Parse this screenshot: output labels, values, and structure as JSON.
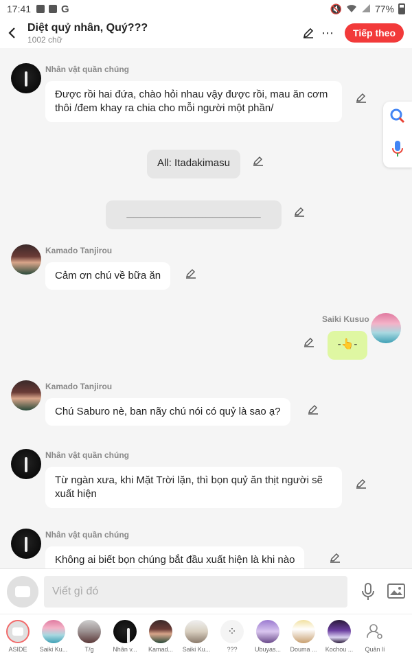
{
  "status_bar": {
    "time": "17:41",
    "battery": "77%"
  },
  "header": {
    "title": "Diệt quỷ nhân, Quý???",
    "subtitle": "1002 chữ",
    "follow_label": "Tiếp theo"
  },
  "messages": [
    {
      "name": "Nhân vật quần chúng",
      "text": "Được rồi hai đứa, chào hỏi nhau vậy được rồi, mau ăn cơm thôi /đem khay ra chia cho mỗi người một phần/"
    },
    {
      "text": "All: Itadakimasu"
    },
    {
      "text": "_______________________________________"
    },
    {
      "name": "Kamado Tanjirou",
      "text": "Cảm ơn chú về bữa ăn"
    },
    {
      "name": "Saiki Kusuo",
      "text": "-👆-"
    },
    {
      "name": "Kamado Tanjirou",
      "text": "Chú Saburo nè, ban nãy chú nói có quỷ là sao ạ?"
    },
    {
      "name": "Nhân vật quần chúng",
      "text": "Từ ngàn xưa, khi Mặt Trời lặn, thì bọn quỷ ăn thịt người sẽ xuất hiện"
    },
    {
      "name": "Nhân vật quần chúng",
      "text": "Không ai biết bọn chúng bắt đầu xuất hiện là khi nào"
    }
  ],
  "input": {
    "placeholder": "Viết gì đó"
  },
  "characters": [
    {
      "label": "ASIDE"
    },
    {
      "label": "Saiki Ku..."
    },
    {
      "label": "T/g"
    },
    {
      "label": "Nhân v..."
    },
    {
      "label": "Kamad..."
    },
    {
      "label": "Saiki Ku..."
    },
    {
      "label": "???"
    },
    {
      "label": "Ubuyas..."
    },
    {
      "label": "Douma ..."
    },
    {
      "label": "Kochou ..."
    },
    {
      "label": "Quản lí"
    }
  ],
  "colors": {
    "accent": "#f23a3a",
    "self_bubble": "#dff7a2",
    "system_bubble": "#e6e6e6"
  }
}
